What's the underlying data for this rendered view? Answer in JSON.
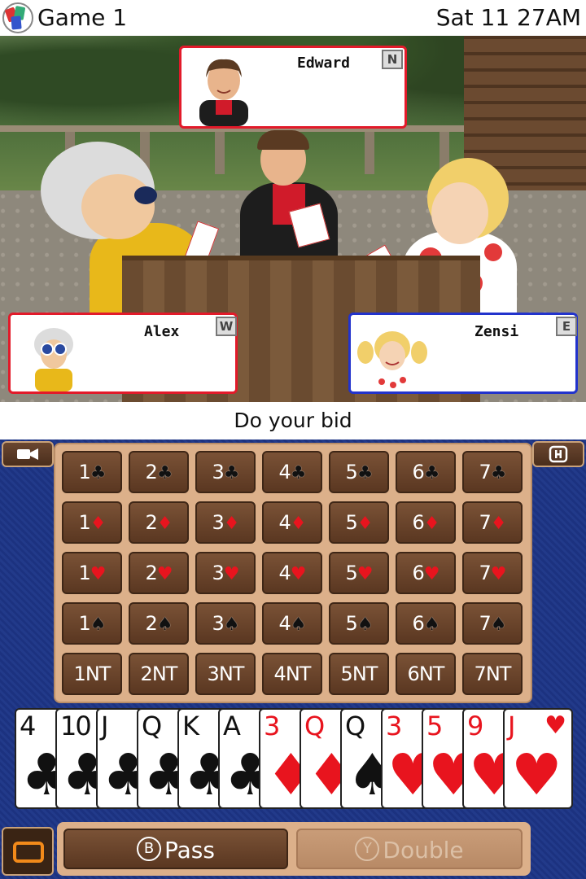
{
  "status": {
    "title": "Game 1",
    "clock": "Sat 11 27AM"
  },
  "players": {
    "north": {
      "name": "Edward",
      "seat": "N",
      "border": "#e21a2a"
    },
    "west": {
      "name": "Alex",
      "seat": "W",
      "border": "#e21a2a"
    },
    "east": {
      "name": "Zensi",
      "seat": "E",
      "border": "#2233cc"
    }
  },
  "prompt": "Do your bid",
  "controls": {
    "camera_icon": "camera-icon",
    "help_icon": "help-icon"
  },
  "bids": [
    [
      {
        "level": "1",
        "suit": "♣",
        "color": "black"
      },
      {
        "level": "2",
        "suit": "♣",
        "color": "black"
      },
      {
        "level": "3",
        "suit": "♣",
        "color": "black"
      },
      {
        "level": "4",
        "suit": "♣",
        "color": "black"
      },
      {
        "level": "5",
        "suit": "♣",
        "color": "black"
      },
      {
        "level": "6",
        "suit": "♣",
        "color": "black"
      },
      {
        "level": "7",
        "suit": "♣",
        "color": "black"
      }
    ],
    [
      {
        "level": "1",
        "suit": "♦",
        "color": "red"
      },
      {
        "level": "2",
        "suit": "♦",
        "color": "red"
      },
      {
        "level": "3",
        "suit": "♦",
        "color": "red"
      },
      {
        "level": "4",
        "suit": "♦",
        "color": "red"
      },
      {
        "level": "5",
        "suit": "♦",
        "color": "red"
      },
      {
        "level": "6",
        "suit": "♦",
        "color": "red"
      },
      {
        "level": "7",
        "suit": "♦",
        "color": "red"
      }
    ],
    [
      {
        "level": "1",
        "suit": "♥",
        "color": "red"
      },
      {
        "level": "2",
        "suit": "♥",
        "color": "red"
      },
      {
        "level": "3",
        "suit": "♥",
        "color": "red"
      },
      {
        "level": "4",
        "suit": "♥",
        "color": "red"
      },
      {
        "level": "5",
        "suit": "♥",
        "color": "red"
      },
      {
        "level": "6",
        "suit": "♥",
        "color": "red"
      },
      {
        "level": "7",
        "suit": "♥",
        "color": "red"
      }
    ],
    [
      {
        "level": "1",
        "suit": "♠",
        "color": "black"
      },
      {
        "level": "2",
        "suit": "♠",
        "color": "black"
      },
      {
        "level": "3",
        "suit": "♠",
        "color": "black"
      },
      {
        "level": "4",
        "suit": "♠",
        "color": "black"
      },
      {
        "level": "5",
        "suit": "♠",
        "color": "black"
      },
      {
        "level": "6",
        "suit": "♠",
        "color": "black"
      },
      {
        "level": "7",
        "suit": "♠",
        "color": "black"
      }
    ],
    [
      {
        "level": "1NT",
        "suit": "",
        "color": "black"
      },
      {
        "level": "2NT",
        "suit": "",
        "color": "black"
      },
      {
        "level": "3NT",
        "suit": "",
        "color": "black"
      },
      {
        "level": "4NT",
        "suit": "",
        "color": "black"
      },
      {
        "level": "5NT",
        "suit": "",
        "color": "black"
      },
      {
        "level": "6NT",
        "suit": "",
        "color": "black"
      },
      {
        "level": "7NT",
        "suit": "",
        "color": "black"
      }
    ]
  ],
  "hand": [
    {
      "rank": "4",
      "suit": "♣",
      "color": "black"
    },
    {
      "rank": "10",
      "suit": "♣",
      "color": "black"
    },
    {
      "rank": "J",
      "suit": "♣",
      "color": "black"
    },
    {
      "rank": "Q",
      "suit": "♣",
      "color": "black"
    },
    {
      "rank": "K",
      "suit": "♣",
      "color": "black"
    },
    {
      "rank": "A",
      "suit": "♣",
      "color": "black"
    },
    {
      "rank": "3",
      "suit": "♦",
      "color": "red"
    },
    {
      "rank": "Q",
      "suit": "♦",
      "color": "red"
    },
    {
      "rank": "Q",
      "suit": "♠",
      "color": "black"
    },
    {
      "rank": "3",
      "suit": "♥",
      "color": "red"
    },
    {
      "rank": "5",
      "suit": "♥",
      "color": "red"
    },
    {
      "rank": "9",
      "suit": "♥",
      "color": "red"
    },
    {
      "rank": "J",
      "suit": "♥",
      "color": "red"
    }
  ],
  "actions": {
    "pass": {
      "glyph": "B",
      "label": "Pass",
      "enabled": true
    },
    "double": {
      "glyph": "Y",
      "label": "Double",
      "enabled": false
    }
  }
}
